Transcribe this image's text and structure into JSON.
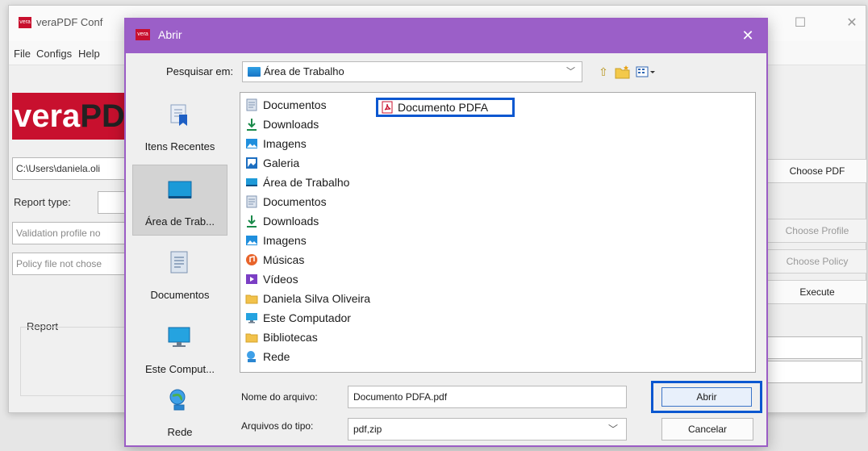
{
  "main_window": {
    "title": "veraPDF Conf",
    "menu": [
      "File",
      "Configs",
      "Help"
    ],
    "logo_text_a": "vera",
    "logo_text_b": "PD",
    "pdf_path": "C:\\Users\\daniela.oli",
    "report_type_label": "Report type:",
    "validation_profile": "Validation profile no",
    "policy_file": "Policy file not chose",
    "buttons": {
      "choose_pdf": "Choose PDF",
      "choose_profile": "Choose Profile",
      "choose_policy": "Choose Policy",
      "execute": "Execute"
    },
    "report_label": "Report"
  },
  "dialog": {
    "title": "Abrir",
    "app_badge": "vera",
    "look_in_label": "Pesquisar em:",
    "look_in_value": "Área de Trabalho",
    "places": [
      {
        "label": "Itens Recentes",
        "icon": "recent-items-icon"
      },
      {
        "label": "Área de Trab...",
        "icon": "desktop-icon"
      },
      {
        "label": "Documentos",
        "icon": "documents-icon"
      },
      {
        "label": "Este Comput...",
        "icon": "computer-icon"
      },
      {
        "label": "Rede",
        "icon": "network-icon"
      }
    ],
    "files": [
      {
        "label": "Documentos",
        "icon": "document-folder-icon"
      },
      {
        "label": "Downloads",
        "icon": "download-icon"
      },
      {
        "label": "Imagens",
        "icon": "image-icon"
      },
      {
        "label": "Galeria",
        "icon": "gallery-icon"
      },
      {
        "label": "Área de Trabalho",
        "icon": "desktop-folder-icon"
      },
      {
        "label": "Documentos",
        "icon": "document-folder-icon"
      },
      {
        "label": "Downloads",
        "icon": "download-icon"
      },
      {
        "label": "Imagens",
        "icon": "image-icon"
      },
      {
        "label": "Músicas",
        "icon": "music-icon"
      },
      {
        "label": "Vídeos",
        "icon": "video-icon"
      },
      {
        "label": "Daniela Silva Oliveira",
        "icon": "folder-icon"
      },
      {
        "label": "Este Computador",
        "icon": "computer-icon"
      },
      {
        "label": "Bibliotecas",
        "icon": "folder-icon"
      },
      {
        "label": "Rede",
        "icon": "network-icon"
      }
    ],
    "pdf_file": "Documento PDFA",
    "file_name_label": "Nome do arquivo:",
    "file_name_value": "Documento PDFA.pdf",
    "file_type_label": "Arquivos do tipo:",
    "file_type_value": "pdf,zip",
    "open_button": "Abrir",
    "cancel_button": "Cancelar"
  },
  "colors": {
    "dialog_accent": "#9b5fc8",
    "highlight": "#0b57d0",
    "brand": "#c8102e"
  }
}
